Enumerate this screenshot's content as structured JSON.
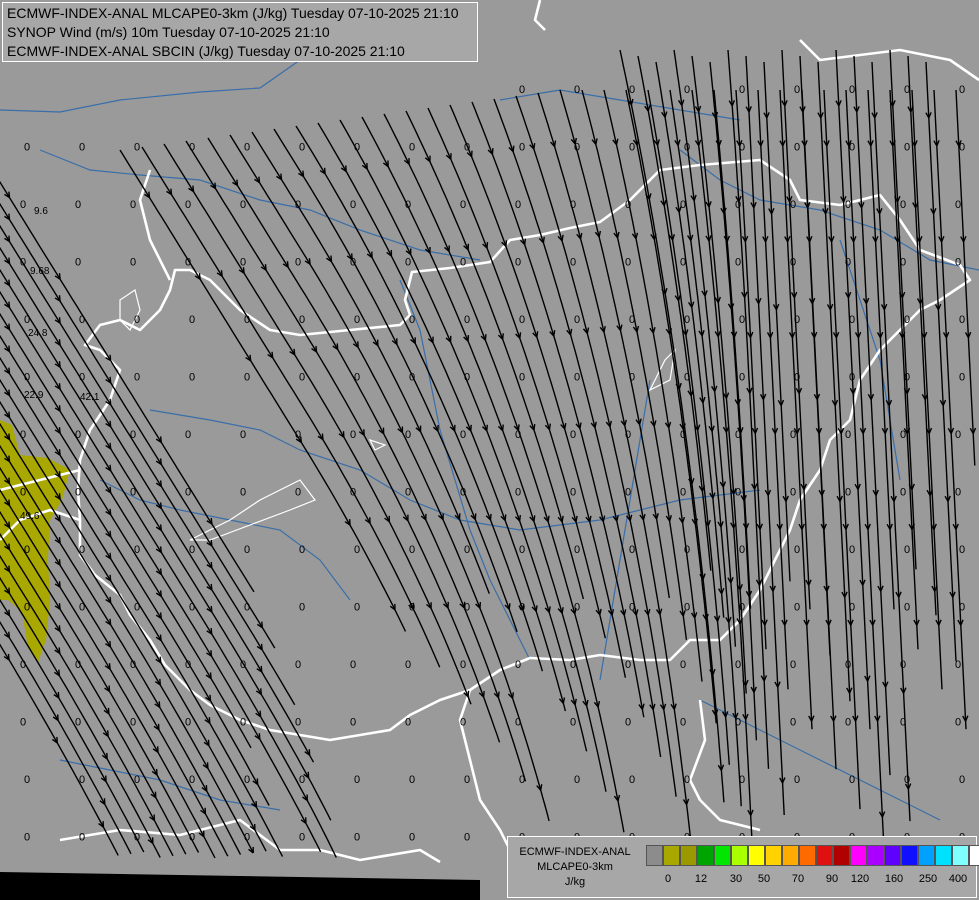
{
  "header": {
    "line1": "ECMWF-INDEX-ANAL MLCAPE0-3km (J/kg) Tuesday 07-10-2025 21:10",
    "line2": "SYNOP Wind (m/s) 10m Tuesday 07-10-2025 21:10",
    "line3": "ECMWF-INDEX-ANAL SBCIN (J/kg) Tuesday 07-10-2025 21:10"
  },
  "legend": {
    "name1": "ECMWF-INDEX-ANAL",
    "name2": "MLCAPE0-3km",
    "unit": "J/kg",
    "colors": [
      "#8c8c8c",
      "#a8a800",
      "#9a9a00",
      "#00a400",
      "#00e600",
      "#aaff00",
      "#ffff00",
      "#ffd200",
      "#ffaa00",
      "#ff6a00",
      "#e01010",
      "#b00000",
      "#ff00ff",
      "#aa00ff",
      "#6000ff",
      "#1010ff",
      "#00a0ff",
      "#00e0ff",
      "#80ffff",
      "#ffffff"
    ],
    "ticks": [
      "0",
      "12",
      "30",
      "50",
      "70",
      "90",
      "120",
      "160",
      "250",
      "400"
    ]
  },
  "map_labels": [
    "9.6",
    "9.68",
    "24.8",
    "22.9",
    "42.1",
    "49.6"
  ],
  "cin_value": "0",
  "colors": {
    "background": "#9a9a9a",
    "border": "#ffffff",
    "river": "#3a6ea8",
    "cape_fill": "#a8a800",
    "streamline": "#000000"
  }
}
